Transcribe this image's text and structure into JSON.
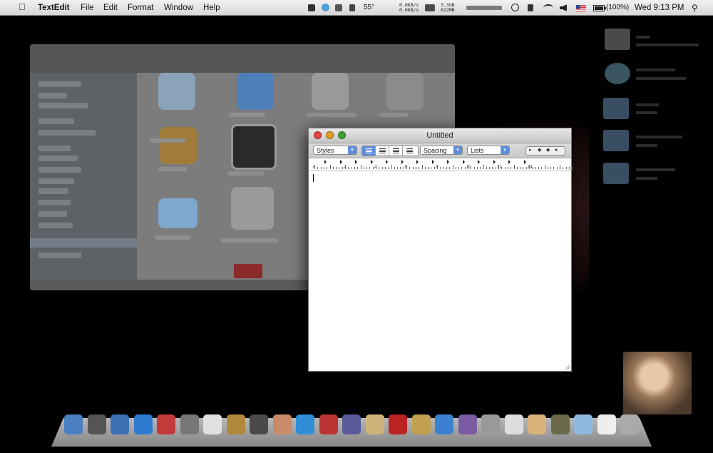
{
  "menubar": {
    "app_name": "TextEdit",
    "menus": [
      "File",
      "Edit",
      "Format",
      "Window",
      "Help"
    ],
    "temperature": "55°",
    "net_rates": "0.0KB/s\n0.0KB/s",
    "memory": "3.3GB\n622MB",
    "battery": "(100%)",
    "clock": "Wed 9:13 PM"
  },
  "textedit": {
    "title": "Untitled",
    "styles_label": "Styles",
    "spacing_label": "Spacing",
    "lists_label": "Lists",
    "ruler_numbers": [
      "0",
      "2",
      "4",
      "6",
      "8",
      "10",
      "12",
      "14"
    ]
  },
  "colors": {
    "accent": "#5f8fdb",
    "close": "#e0443e",
    "minimize": "#dea123",
    "zoom": "#3ca534"
  }
}
